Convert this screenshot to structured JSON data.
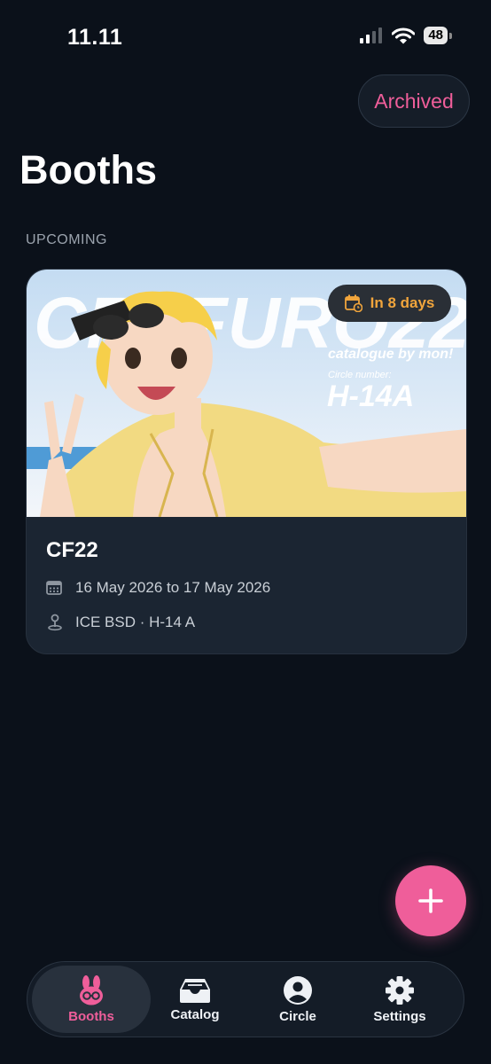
{
  "status_bar": {
    "time": "11.11",
    "battery": "48"
  },
  "header": {
    "archived_label": "Archived",
    "title": "Booths"
  },
  "section": {
    "label": "UPCOMING"
  },
  "booth_card": {
    "banner_text": "CFUFURO22",
    "banner_subtitle": "catalogue by mon!",
    "banner_circle_label": "Circle number:",
    "banner_circle_number": "H-14A",
    "badge_label": "In 8 days",
    "title": "CF22",
    "dates": "16 May 2026 to 17 May 2026",
    "location": "ICE BSD · H-14 A"
  },
  "fab": {
    "icon": "plus-icon"
  },
  "tab_bar": {
    "tabs": [
      {
        "label": "Booths",
        "icon": "bunny-icon",
        "active": true
      },
      {
        "label": "Catalog",
        "icon": "inbox-tray-icon",
        "active": false
      },
      {
        "label": "Circle",
        "icon": "person-circle-icon",
        "active": false
      },
      {
        "label": "Settings",
        "icon": "gear-icon",
        "active": false
      }
    ]
  },
  "colors": {
    "background": "#0b111a",
    "accent": "#ef5e9a",
    "badge_text": "#f1a53c",
    "card": "#1b2532"
  }
}
